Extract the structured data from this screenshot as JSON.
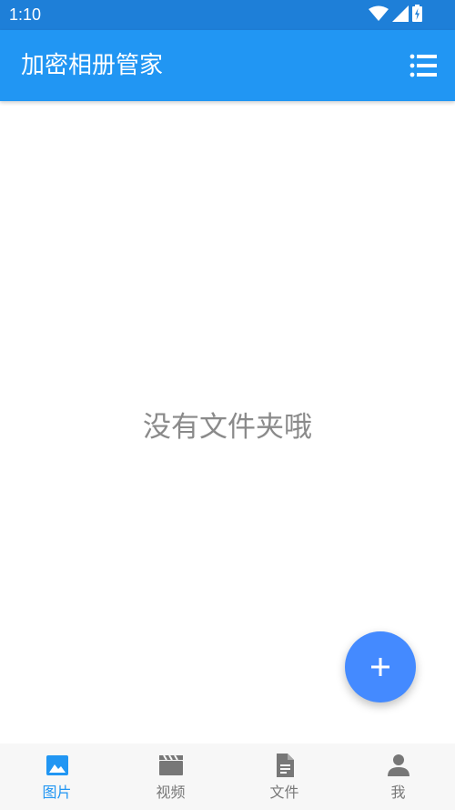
{
  "status": {
    "time": "1:10",
    "icons": [
      "wifi-icon",
      "signal-icon",
      "battery-icon"
    ]
  },
  "appbar": {
    "title": "加密相册管家",
    "menu_icon": "list-icon"
  },
  "main": {
    "empty_message": "没有文件夹哦"
  },
  "fab": {
    "icon": "plus-icon"
  },
  "bottom_nav": [
    {
      "label": "图片",
      "icon": "image-icon",
      "active": true
    },
    {
      "label": "视频",
      "icon": "video-icon",
      "active": false
    },
    {
      "label": "文件",
      "icon": "file-icon",
      "active": false
    },
    {
      "label": "我",
      "icon": "person-icon",
      "active": false
    }
  ],
  "colors": {
    "primary": "#2196f3",
    "status_bar": "#1e7fd8",
    "fab": "#448aff",
    "inactive": "#777777",
    "empty_text": "#8a8a8a"
  }
}
